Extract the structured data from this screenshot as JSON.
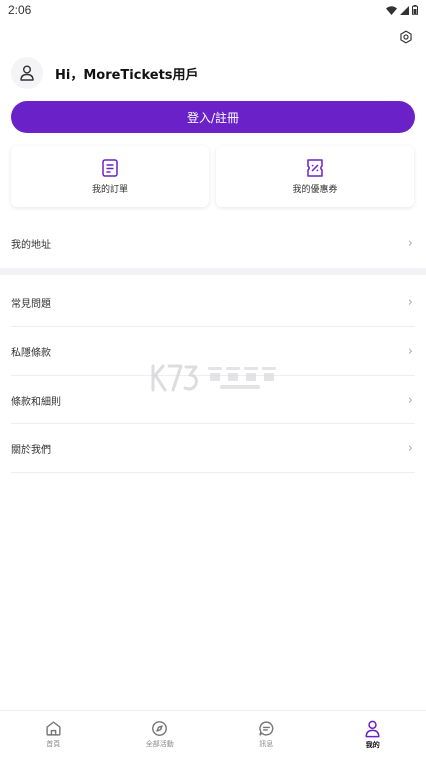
{
  "status_bar": {
    "time": "2:06"
  },
  "header": {
    "greeting": "Hi，MoreTickets用戶"
  },
  "login": {
    "label": "登入/註冊"
  },
  "cards": [
    {
      "label": "我的訂單",
      "icon": "order-list-icon"
    },
    {
      "label": "我的優惠券",
      "icon": "coupon-icon"
    }
  ],
  "menu": {
    "address": "我的地址",
    "items": [
      {
        "label": "常見問題"
      },
      {
        "label": "私隱條款"
      },
      {
        "label": "條款和細則"
      },
      {
        "label": "關於我們"
      }
    ]
  },
  "bottom_nav": [
    {
      "label": "首頁",
      "icon": "home-icon",
      "active": false
    },
    {
      "label": "全部活動",
      "icon": "compass-icon",
      "active": false
    },
    {
      "label": "訊息",
      "icon": "chat-icon",
      "active": false
    },
    {
      "label": "我的",
      "icon": "user-icon",
      "active": true
    }
  ],
  "colors": {
    "accent": "#6a22c8",
    "active_nav": "#6a22c8"
  }
}
